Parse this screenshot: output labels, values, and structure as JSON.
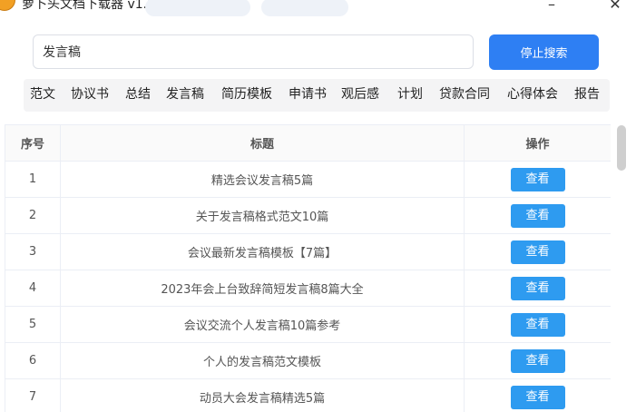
{
  "window": {
    "title": "萝卜头文档下载器 v1.1",
    "minimize_glyph": "–",
    "close_glyph": "✕"
  },
  "search": {
    "value": "发言稿",
    "button_label": "停止搜索"
  },
  "categories": [
    "范文",
    "协议书",
    "总结",
    "发言稿",
    "简历模板",
    "申请书",
    "观后感",
    "计划",
    "贷款合同",
    "心得体会",
    "报告"
  ],
  "table": {
    "headers": [
      "序号",
      "标题",
      "操作"
    ],
    "rows": [
      {
        "index": "1",
        "title": "精选会议发言稿5篇",
        "action": "查看"
      },
      {
        "index": "2",
        "title": "关于发言稿格式范文10篇",
        "action": "查看"
      },
      {
        "index": "3",
        "title": "会议最新发言稿模板【7篇】",
        "action": "查看"
      },
      {
        "index": "4",
        "title": "2023年会上台致辞简短发言稿8篇大全",
        "action": "查看"
      },
      {
        "index": "5",
        "title": "会议交流个人发言稿10篇参考",
        "action": "查看"
      },
      {
        "index": "6",
        "title": "个人的发言稿范文模板",
        "action": "查看"
      },
      {
        "index": "7",
        "title": "动员大会发言稿精选5篇",
        "action": "查看"
      }
    ]
  },
  "colors": {
    "primary_button": "#2e7ff3",
    "view_button": "#2e9bf0",
    "app_icon": "orange"
  }
}
